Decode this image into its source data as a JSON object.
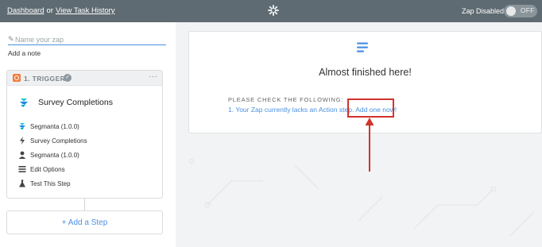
{
  "topbar": {
    "dashboard_link": "Dashboard",
    "or_text": "or",
    "history_link": "View Task History",
    "logo_icon": "zapier-asterisk-icon",
    "zap_status": "Zap Disabled",
    "toggle_text": "OFF"
  },
  "sidebar": {
    "zap_name_placeholder": "Name your zap",
    "zap_name_value": "",
    "add_note": "Add a note",
    "trigger": {
      "label": "1. TRIGGER",
      "more": "···",
      "app_title": "Survey Completions",
      "items": [
        {
          "label": "Segmanta (1.0.0)",
          "icon": "segmanta-icon"
        },
        {
          "label": "Survey Completions",
          "icon": "bolt-icon"
        },
        {
          "label": "Segmanta (1.0.0)",
          "icon": "user-icon"
        },
        {
          "label": "Edit Options",
          "icon": "list-icon"
        },
        {
          "label": "Test This Step",
          "icon": "flask-icon"
        }
      ]
    },
    "add_step": "+ Add a Step"
  },
  "main": {
    "heading": "Almost finished here!",
    "subheading": "PLEASE CHECK THE FOLLOWING:",
    "issue_number": "1.",
    "issue_text": "Your Zap currently lacks an Action step.",
    "issue_link": "Add one now!"
  },
  "colors": {
    "topbar": "#5f6b72",
    "accent": "#4a90e2",
    "trigger_badge": "#f47c3c",
    "annotation": "#d0342c"
  }
}
